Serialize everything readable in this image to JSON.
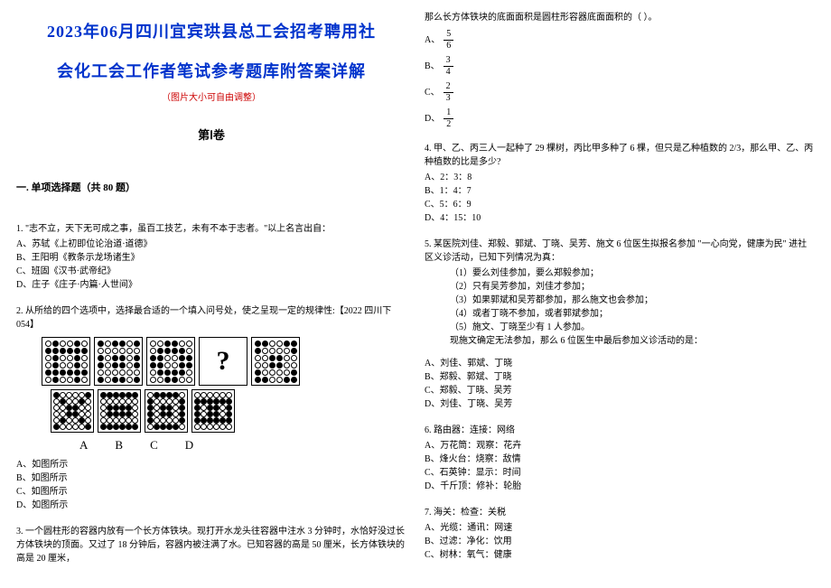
{
  "header": {
    "title_line1": "2023年06月四川宜宾珙县总工会招考聘用社",
    "title_line2": "会化工会工作者笔试参考题库附答案详解",
    "subtitle": "（图片大小可自由调整）",
    "volume": "第Ⅰ卷"
  },
  "section1": {
    "heading": "一. 单项选择题（共 80 题）"
  },
  "q1": {
    "stem": "1. \"志不立，天下无可成之事，虽百工技艺，未有不本于志者。\"以上名言出自：",
    "a": "A、苏轼《上初即位论治道·道德》",
    "b": "B、王阳明《教条示龙场诸生》",
    "c": "C、班固《汉书·武帝纪》",
    "d": "D、庄子《庄子·内篇·人世间》"
  },
  "q2": {
    "stem": "2. 从所给的四个选项中，选择最合适的一个填入问号处，使之呈现一定的规律性:【2022 四川下 054】",
    "optA": "A",
    "optB": "B",
    "optC": "C",
    "optD": "D",
    "a": "A、如图所示",
    "b": "B、如图所示",
    "c": "C、如图所示",
    "d": "D、如图所示"
  },
  "q3": {
    "stem": "3. 一个圆柱形的容器内放有一个长方体铁块。现打开水龙头往容器中注水 3 分钟时，水恰好没过长方体铁块的顶面。又过了 18 分钟后，容器内被注满了水。已知容器的高是 50 厘米，长方体铁块的高是 20 厘米，",
    "cont": "那么长方体铁块的底面面积是圆柱形容器底面面积的（ ）。",
    "fracA_n": "5",
    "fracA_d": "6",
    "fracB_n": "3",
    "fracB_d": "4",
    "fracC_n": "2",
    "fracC_d": "3",
    "fracD_n": "1",
    "fracD_d": "2",
    "la": "A、",
    "lb": "B、",
    "lc": "C、",
    "ld": "D、"
  },
  "q4": {
    "stem": "4. 甲、乙、丙三人一起种了 29 棵树，丙比甲多种了 6 棵，但只是乙种植数的 2/3，那么甲、乙、丙种植数的比是多少?",
    "a": "A、2：3：8",
    "b": "B、1：4：7",
    "c": "C、5：6：9",
    "d": "D、4：15：10"
  },
  "q5": {
    "stem1": "5. 某医院刘佳、郑毅、郭斌、丁晓、吴芳、施文 6 位医生拟报名参加 \"一心向党，健康为民\" 进社区义诊活动，已知下列情况为真：",
    "c1": "（1）要么刘佳参加，要么郑毅参加；",
    "c2": "（2）只有吴芳参加，刘佳才参加；",
    "c3": "（3）如果郭斌和吴芳都参加，那么施文也会参加；",
    "c4": "（4）或者丁晓不参加，或者郭斌参加；",
    "c5": "（5）施文、丁晓至少有 1 人参加。",
    "stem2": "现施文确定无法参加，那么 6 位医生中最后参加义诊活动的是：",
    "a": "A、刘佳、郭斌、丁晓",
    "b": "B、郑毅、郭斌、丁晓",
    "c": "C、郑毅、丁晓、吴芳",
    "d": "D、刘佳、丁晓、吴芳"
  },
  "q6": {
    "stem": "6. 路由器：连接：网络",
    "a": "A、万花筒：观察：花卉",
    "b": "B、烽火台：烧察：敌情",
    "c": "C、石英钟：显示：时间",
    "d": "D、千斤顶：修补：轮胎"
  },
  "q7": {
    "stem": "7. 海关：检查：关税",
    "a": "A、光缆：通讯：网速",
    "b": "B、过滤：净化：饮用",
    "c": "C、树林：氧气：健康"
  }
}
